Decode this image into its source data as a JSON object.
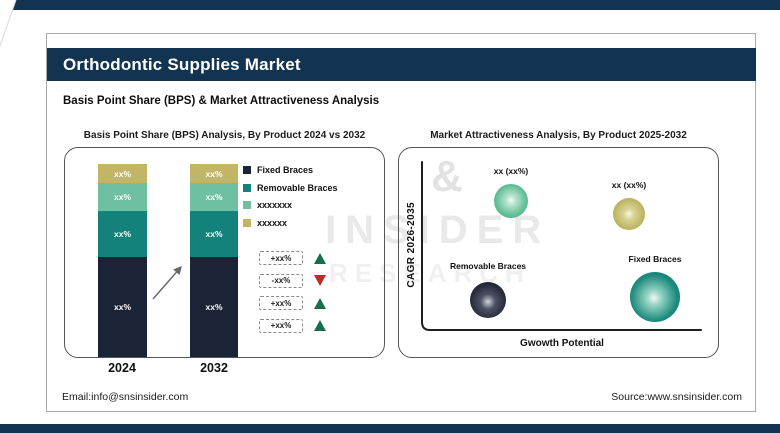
{
  "header": {
    "title": "Orthodontic Supplies Market",
    "subtitle": "Basis Point Share (BPS) & Market Attractiveness Analysis"
  },
  "colors": {
    "banner_navy": "#123450",
    "fixed_braces": "#1b2336",
    "removable_braces": "#12827a",
    "series3": "#6fbfa1",
    "series4": "#c2b566",
    "up_triangle": "#156f4a",
    "down_triangle": "#c62828"
  },
  "watermark": {
    "amp": "&",
    "line1": "INSIDER",
    "line2": "RESEARCH"
  },
  "bps_chart": {
    "title": "Basis Point Share (BPS) Analysis, By Product 2024 vs 2032",
    "bars": [
      {
        "year": "2024",
        "segments": {
          "khaki": "xx%",
          "seafoam": "xx%",
          "teal": "xx%",
          "navy": "xx%"
        }
      },
      {
        "year": "2032",
        "segments": {
          "khaki": "xx%",
          "seafoam": "xx%",
          "teal": "xx%",
          "navy": "xx%"
        }
      }
    ],
    "legend": [
      {
        "label": "Fixed Braces"
      },
      {
        "label": "Removable Braces"
      },
      {
        "label": "xxxxxxx"
      },
      {
        "label": "xxxxxx"
      }
    ],
    "changes": [
      {
        "value": "+xx%",
        "direction": "up"
      },
      {
        "value": "-xx%",
        "direction": "down"
      },
      {
        "value": "+xx%",
        "direction": "up"
      },
      {
        "value": "+xx%",
        "direction": "up"
      }
    ]
  },
  "attractiveness_chart": {
    "title": "Market Attractiveness Analysis, By Product 2025-2032",
    "y_axis_label": "CAGR 2026-2035",
    "x_axis_label": "Gwowth Potential",
    "bubbles": [
      {
        "label": "xx (xx%)"
      },
      {
        "label": "xx (xx%)"
      },
      {
        "label": "Removable Braces"
      },
      {
        "label": "Fixed Braces"
      }
    ]
  },
  "footer": {
    "email": "Email:info@snsinsider.com",
    "source": "Source:www.snsinsider.com"
  },
  "chart_data": [
    {
      "type": "bar",
      "subtype": "stacked",
      "title": "Basis Point Share (BPS) Analysis, By Product 2024 vs 2032",
      "categories": [
        "2024",
        "2032"
      ],
      "series": [
        {
          "name": "Fixed Braces",
          "color": "#1b2336",
          "values": [
            "xx%",
            "xx%"
          ],
          "approx_share_pct": [
            52,
            52
          ]
        },
        {
          "name": "Removable Braces",
          "color": "#12827a",
          "values": [
            "xx%",
            "xx%"
          ],
          "approx_share_pct": [
            24,
            24
          ]
        },
        {
          "name": "xxxxxxx",
          "color": "#6fbfa1",
          "values": [
            "xx%",
            "xx%"
          ],
          "approx_share_pct": [
            14,
            14
          ]
        },
        {
          "name": "xxxxxx",
          "color": "#c2b566",
          "values": [
            "xx%",
            "xx%"
          ],
          "approx_share_pct": [
            10,
            10
          ]
        }
      ],
      "annotations": [
        {
          "text": "+xx%",
          "direction": "up"
        },
        {
          "text": "-xx%",
          "direction": "down"
        },
        {
          "text": "+xx%",
          "direction": "up"
        },
        {
          "text": "+xx%",
          "direction": "up"
        }
      ],
      "legend_position": "right",
      "grid": false
    },
    {
      "type": "scatter",
      "subtype": "bubble",
      "title": "Market Attractiveness Analysis, By Product 2025-2032",
      "xlabel": "Gwowth Potential",
      "ylabel": "CAGR 2026-2035",
      "points": [
        {
          "label": "xx (xx%)",
          "color": "#5fbd95",
          "x": "low-mid",
          "y": "high",
          "size": "medium"
        },
        {
          "label": "xx (xx%)",
          "color": "#bcb35e",
          "x": "mid-high",
          "y": "high",
          "size": "small"
        },
        {
          "label": "Removable Braces",
          "color": "#232837",
          "x": "low",
          "y": "low",
          "size": "medium"
        },
        {
          "label": "Fixed Braces",
          "color": "#17837b",
          "x": "high",
          "y": "low",
          "size": "large"
        }
      ],
      "grid": false,
      "legend_position": "none"
    }
  ]
}
